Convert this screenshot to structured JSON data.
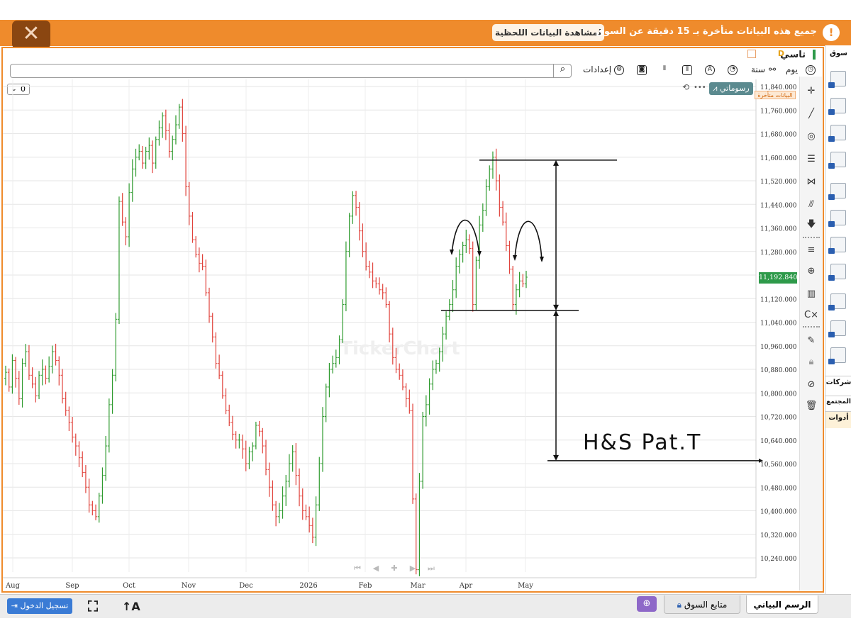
{
  "banner": {
    "notice": "جميع هذه البيانات متأخرة بـ 15 دقيقة عن السوق",
    "live_button": "لمشاهدة البيانات اللحظية"
  },
  "symbol": {
    "name": "تاسي",
    "period_badge": "D"
  },
  "toolbar": {
    "day_label": "يوم",
    "year_label": "سنة",
    "settings_label": "إعدادات"
  },
  "chart_controls": {
    "zero_select": "0",
    "chart_type_button": "رسوماتي",
    "dots": "•••",
    "delayed_label": "البيانات متأخرة",
    "last_price": "11,192.840",
    "watermark": "TickerChart"
  },
  "right_sidebar": {
    "market_tab": "سوق",
    "companies_tab": "شركات",
    "community_tab": "المجتمع",
    "tools_tab": "أدوات"
  },
  "bottom": {
    "login_button": "تسجيل الدخول",
    "tab_chart": "الرسم البياني",
    "tab_market_watch": "متابع السوق"
  },
  "annotation": {
    "text": "H&S Pat.T"
  },
  "chart_data": {
    "type": "ohlc",
    "title": "",
    "xlabel": "",
    "ylabel": "",
    "ylim": [
      10200,
      11850
    ],
    "y_ticks": [
      "11,840.000",
      "11,760.000",
      "11,680.000",
      "11,600.000",
      "11,520.000",
      "11,440.000",
      "11,360.000",
      "11,280.000",
      "11,200.000",
      "11,120.000",
      "11,040.000",
      "10,960.000",
      "10,880.000",
      "10,800.000",
      "10,720.000",
      "10,640.000",
      "10,560.000",
      "10,480.000",
      "10,400.000",
      "10,320.000",
      "10,240.000"
    ],
    "x_ticks": [
      "Aug",
      "Sep",
      "Oct",
      "Nov",
      "Dec",
      "2026",
      "Feb",
      "Mar",
      "Apr",
      "May"
    ],
    "closes": [
      10870,
      10820,
      10910,
      10850,
      10780,
      10900,
      10940,
      10860,
      10830,
      10790,
      10860,
      10880,
      10850,
      10890,
      10940,
      10910,
      10860,
      10780,
      10740,
      10700,
      10650,
      10620,
      10580,
      10530,
      10480,
      10420,
      10400,
      10380,
      10450,
      10520,
      10620,
      10760,
      10860,
      11050,
      11450,
      11380,
      11330,
      11480,
      11560,
      11600,
      11620,
      11580,
      11620,
      11640,
      11580,
      11660,
      11700,
      11740,
      11690,
      11620,
      11660,
      11710,
      11770,
      11680,
      11500,
      11400,
      11320,
      11270,
      11240,
      11230,
      11140,
      11060,
      10990,
      10900,
      10860,
      10790,
      10740,
      10700,
      10660,
      10640,
      10640,
      10610,
      10560,
      10600,
      10620,
      10690,
      10670,
      10620,
      10540,
      10480,
      10420,
      10380,
      10400,
      10450,
      10500,
      10560,
      10600,
      10520,
      10450,
      10400,
      10380,
      10350,
      10310,
      10420,
      10560,
      10720,
      10820,
      10880,
      10900,
      10920,
      10980,
      11100,
      11280,
      11400,
      11470,
      11430,
      11350,
      11280,
      11230,
      11210,
      11180,
      11170,
      11150,
      11140,
      11100,
      11000,
      10920,
      10880,
      10860,
      10820,
      10780,
      10740,
      10440,
      10200,
      10500,
      10720,
      10760,
      10830,
      10880,
      10900,
      10940,
      11000,
      11060,
      11100,
      11150,
      11230,
      11270,
      11300,
      11320,
      11290,
      11100,
      11250,
      11370,
      11420,
      11500,
      11560,
      11600,
      11520,
      11430,
      11380,
      11300,
      11220,
      11100,
      11150,
      11180,
      11170,
      11192.84
    ],
    "last_price": 11192.84,
    "drawings": {
      "neckline": 11080,
      "head_top": 11590,
      "target": 10570,
      "label": "H&S Pat.T"
    }
  }
}
